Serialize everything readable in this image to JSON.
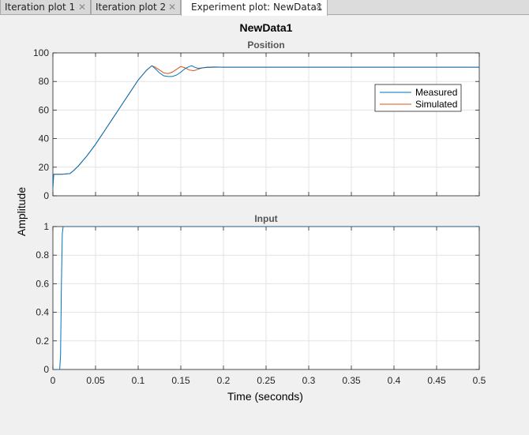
{
  "tabs": [
    {
      "label": "Iteration plot 1",
      "active": false
    },
    {
      "label": "Iteration plot 2",
      "active": false
    },
    {
      "label": "Experiment plot: NewData1",
      "active": true
    }
  ],
  "figure": {
    "title": "NewData1",
    "ylabel": "Amplitude",
    "xlabel": "Time (seconds)"
  },
  "chart_data": [
    {
      "type": "line",
      "title": "Position",
      "xlim": [
        0,
        0.5
      ],
      "ylim": [
        0,
        100
      ],
      "xticks": [
        0,
        0.05,
        0.1,
        0.15,
        0.2,
        0.25,
        0.3,
        0.35,
        0.4,
        0.45,
        0.5
      ],
      "yticks": [
        0,
        20,
        40,
        60,
        80,
        100
      ],
      "ytick_labels": [
        "0",
        "20",
        "40",
        "60",
        "80",
        "100"
      ],
      "show_x_tick_labels": false,
      "grid": true,
      "legend": {
        "location": "right",
        "entries": [
          "Measured",
          "Simulated"
        ]
      },
      "series": [
        {
          "name": "Measured",
          "color": "#0072BD",
          "x": [
            0,
            0.001,
            0.005,
            0.01,
            0.02,
            0.025,
            0.03,
            0.04,
            0.05,
            0.06,
            0.07,
            0.08,
            0.09,
            0.1,
            0.11,
            0.116,
            0.12,
            0.125,
            0.13,
            0.135,
            0.14,
            0.145,
            0.15,
            0.155,
            0.16,
            0.163,
            0.166,
            0.17,
            0.175,
            0.18,
            0.19,
            0.2,
            0.25,
            0.3,
            0.35,
            0.4,
            0.45,
            0.5
          ],
          "y": [
            5,
            15,
            15,
            15,
            15.5,
            18,
            21,
            28,
            36,
            45,
            54,
            63,
            72,
            81,
            88,
            91,
            89,
            86,
            84,
            83.5,
            83.5,
            84.5,
            86.5,
            89,
            90.5,
            91,
            90,
            89.2,
            89.5,
            89.8,
            90,
            90,
            90,
            90,
            90,
            90,
            90,
            90
          ]
        },
        {
          "name": "Simulated",
          "color": "#D95319",
          "x": [
            0,
            0.01,
            0.02,
            0.025,
            0.03,
            0.04,
            0.05,
            0.06,
            0.07,
            0.08,
            0.09,
            0.1,
            0.11,
            0.116,
            0.12,
            0.125,
            0.13,
            0.135,
            0.14,
            0.145,
            0.15,
            0.155,
            0.16,
            0.165,
            0.17,
            0.175,
            0.18,
            0.19,
            0.2,
            0.25,
            0.3,
            0.35,
            0.4,
            0.45,
            0.5
          ],
          "y": [
            15,
            15,
            15.5,
            18,
            21,
            28,
            36,
            45,
            54,
            63,
            72,
            81,
            88,
            91,
            90,
            88,
            86,
            85.5,
            86.5,
            88.5,
            90.5,
            89.5,
            88,
            87.5,
            88.5,
            89.5,
            90,
            90.2,
            90,
            90,
            90,
            90,
            90,
            90,
            90
          ]
        }
      ]
    },
    {
      "type": "line",
      "title": "Input",
      "xlim": [
        0,
        0.5
      ],
      "ylim": [
        0,
        1
      ],
      "xticks": [
        0,
        0.05,
        0.1,
        0.15,
        0.2,
        0.25,
        0.3,
        0.35,
        0.4,
        0.45,
        0.5
      ],
      "xtick_labels": [
        "0",
        "0.05",
        "0.1",
        "0.15",
        "0.2",
        "0.25",
        "0.3",
        "0.35",
        "0.4",
        "0.45",
        "0.5"
      ],
      "yticks": [
        0,
        0.2,
        0.4,
        0.6,
        0.8,
        1
      ],
      "ytick_labels": [
        "0",
        "0.2",
        "0.4",
        "0.6",
        "0.8",
        "1"
      ],
      "show_x_tick_labels": true,
      "grid": true,
      "series": [
        {
          "name": "Measured",
          "color": "#0072BD",
          "x": [
            0,
            0.008,
            0.009,
            0.01,
            0.011,
            0.012,
            0.5
          ],
          "y": [
            0,
            0,
            0.1,
            0.6,
            0.95,
            1,
            1
          ]
        }
      ]
    }
  ]
}
